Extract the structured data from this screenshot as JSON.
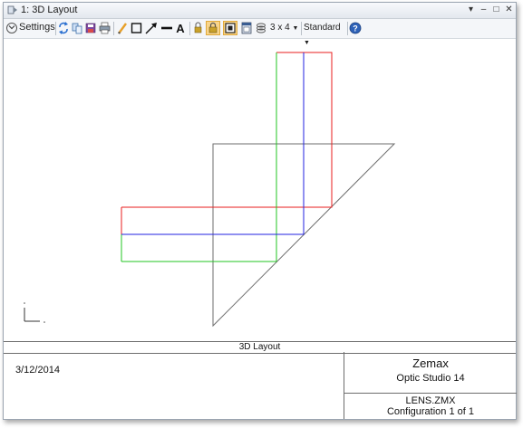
{
  "window": {
    "title": "1: 3D Layout",
    "controls": {
      "menu": "▾",
      "minimize": "–",
      "maximize": "□",
      "close": "✕"
    }
  },
  "toolbar": {
    "settings_label": "Settings",
    "layout_label": "3 x 4",
    "style_label": "Standard",
    "icons": [
      "refresh-icon",
      "copy-icon",
      "save-icon",
      "print-icon",
      "pencil-icon",
      "rectangle-icon",
      "arrow-icon",
      "line-icon",
      "text-icon",
      "lock-icon",
      "lock-active-icon",
      "fit-icon",
      "window-icon",
      "layers-icon",
      "help-icon"
    ]
  },
  "plot": {
    "colors": {
      "gray": "#6e6e6e",
      "red": "#e81d1d",
      "green": "#22c422",
      "blue": "#2222e0"
    }
  },
  "footer": {
    "title": "3D Layout",
    "date": "3/12/2014",
    "company": "Zemax",
    "product": "Optic Studio 14",
    "file": "LENS.ZMX",
    "configuration": "Configuration 1 of 1"
  }
}
